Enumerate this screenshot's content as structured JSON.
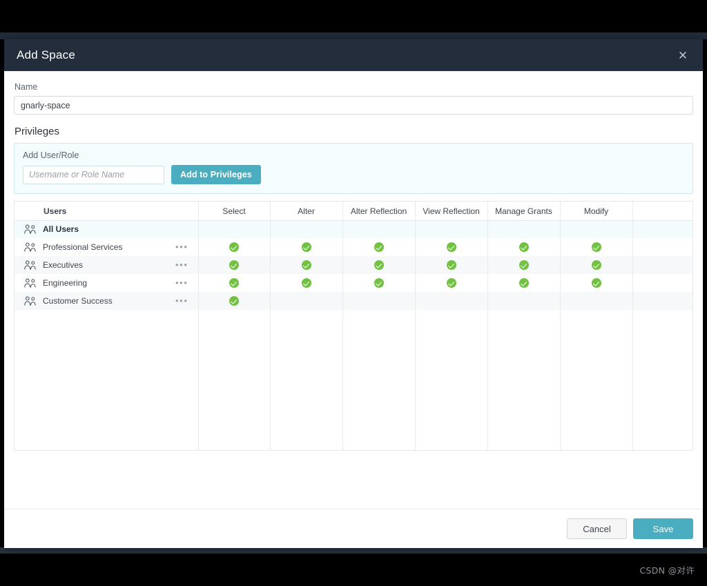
{
  "modal": {
    "title": "Add Space",
    "close_icon": "close-icon"
  },
  "name_field": {
    "label": "Name",
    "value": "gnarly-space",
    "placeholder": "Name"
  },
  "privileges": {
    "section_label": "Privileges",
    "add_panel": {
      "label": "Add User/Role",
      "input_placeholder": "Username or Role Name",
      "input_value": "",
      "button_label": "Add to Privileges"
    },
    "table": {
      "columns": [
        "Users",
        "Select",
        "Alter",
        "Alter Reflection",
        "View Reflection",
        "Manage Grants",
        "Modify"
      ],
      "rows": [
        {
          "name": "All Users",
          "icon": "users-icon",
          "highlight": true,
          "menu": "",
          "grants": [
            false,
            false,
            false,
            false,
            false,
            false
          ]
        },
        {
          "name": "Professional Services",
          "icon": "users-icon",
          "highlight": false,
          "menu": "•••",
          "grants": [
            true,
            true,
            true,
            true,
            true,
            true
          ]
        },
        {
          "name": "Executives",
          "icon": "users-icon",
          "highlight": false,
          "menu": "•••",
          "grants": [
            true,
            true,
            true,
            true,
            true,
            true
          ]
        },
        {
          "name": "Engineering",
          "icon": "users-icon",
          "highlight": false,
          "menu": "•••",
          "grants": [
            true,
            true,
            true,
            true,
            true,
            true
          ]
        },
        {
          "name": "Customer Success",
          "icon": "users-icon",
          "highlight": false,
          "menu": "•••",
          "grants": [
            true,
            false,
            false,
            false,
            false,
            false
          ]
        }
      ]
    }
  },
  "footer": {
    "cancel_label": "Cancel",
    "save_label": "Save"
  },
  "watermark": "CSDN @对许",
  "colors": {
    "header_bg": "#242d3c",
    "accent": "#4aaec0",
    "check_green": "#72c242",
    "panel_bg": "#f5fcfd",
    "highlight_row": "#f4fbfd"
  }
}
